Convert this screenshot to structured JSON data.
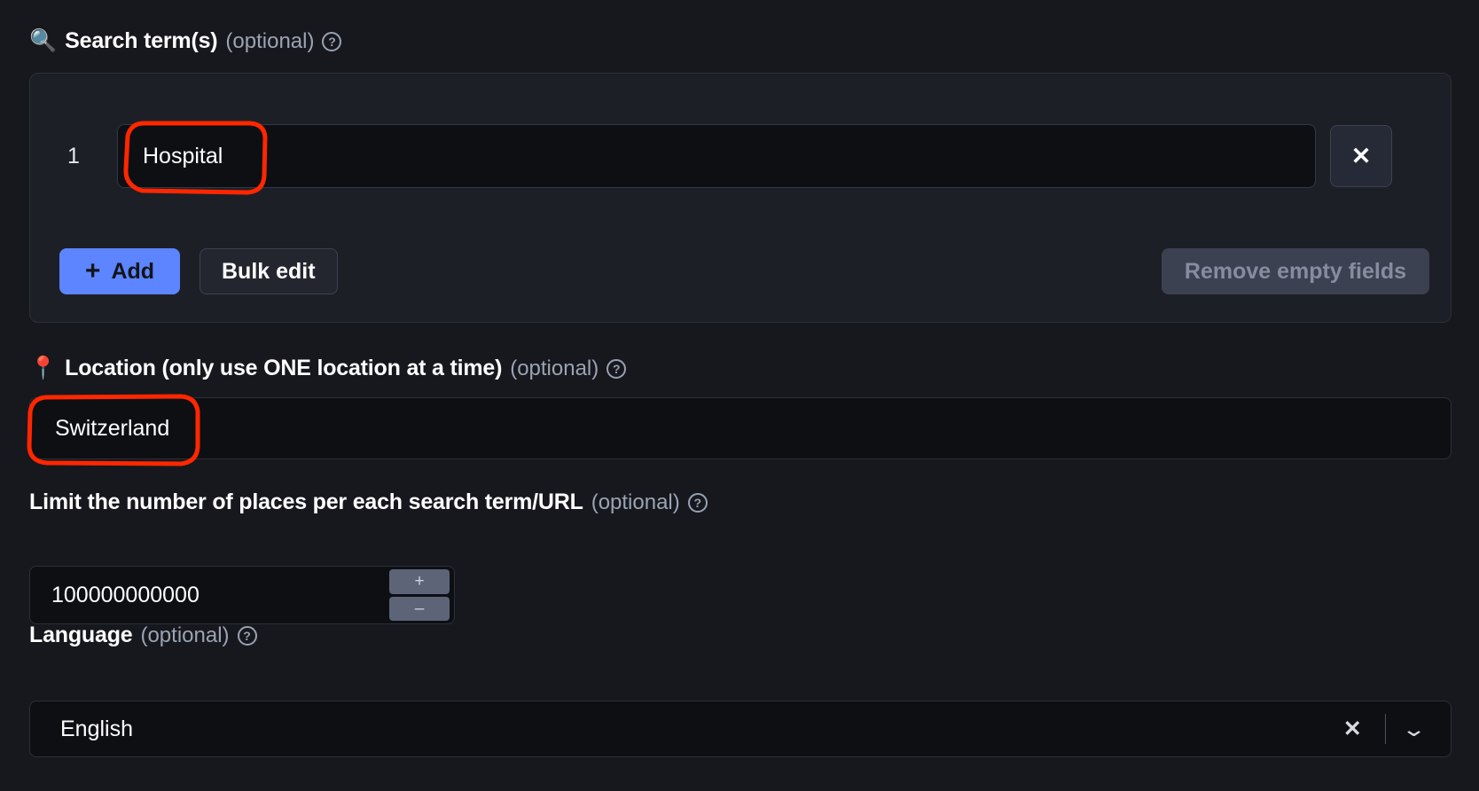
{
  "search_terms": {
    "emoji": "🔍",
    "icon_name": "magnifying-glass-icon",
    "label": "Search term(s)",
    "optional": "(optional)",
    "help": "?",
    "rows": [
      {
        "index": "1",
        "value": "Hospital",
        "placeholder": ""
      }
    ],
    "remove_row_glyph": "✕",
    "add_label": "Add",
    "add_plus": "+",
    "bulk_edit_label": "Bulk edit",
    "remove_empty_label": "Remove empty fields"
  },
  "location": {
    "emoji": "📍",
    "icon_name": "map-pin-icon",
    "label": "Location (only use ONE location at a time)",
    "optional": "(optional)",
    "help": "?",
    "value": "Switzerland",
    "placeholder": ""
  },
  "limit": {
    "label": "Limit the number of places per each search term/URL",
    "optional": "(optional)",
    "help": "?",
    "value": "100000000000",
    "increment_glyph": "+",
    "decrement_glyph": "–"
  },
  "language": {
    "label": "Language",
    "optional": "(optional)",
    "help": "?",
    "value": "English",
    "clear_glyph": "✕",
    "chevron_glyph": "⌄"
  },
  "annotations": {
    "color": "#ff2600",
    "highlight_search_term": "Hospital",
    "highlight_location": "Switzerland"
  }
}
